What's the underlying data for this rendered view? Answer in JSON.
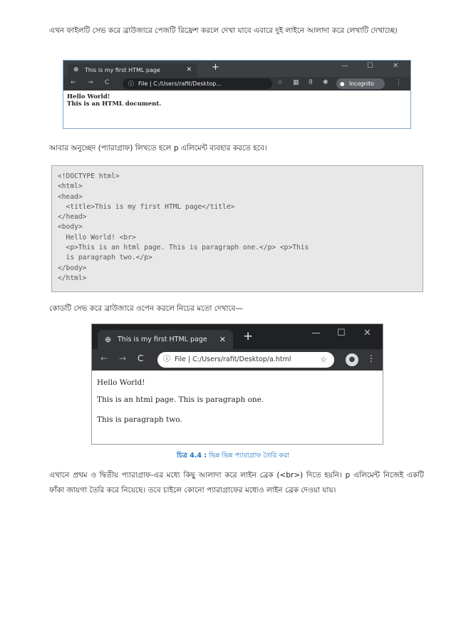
{
  "paragraphs": {
    "p1": "এখন ফাইলটি সেভ করে ব্রাউজারে পেজটি রিফ্রেশ করলে দেখা যাবে এবারে দুই লাইনে আলাদা করে লেখাটি দেখাচ্ছে।",
    "p2": "আবার অনুচ্ছেদ (প্যারাগ্রাফ) লিখতে হলে p এলিমেন্ট ব্যবহার করতে হবে।",
    "p3": "কোডটি সেভ করে ব্রাউজারে ওপেন করলে নিচের মতো দেখাবে—",
    "p4": "এখানে প্রথম ও দ্বিতীয় প্যারাগ্রাফ-এর মধ্যে কিছু আলাদা করে লাইন ব্রেক (<br>) দিতে হয়নি। p এলিমেন্ট নিজেই একটি ফাঁকা জায়গা তৈরি করে নিয়েছে। তবে চাইলে কোনো প্যারাগ্রাফের মধ্যেও লাইন ব্রেক দেওয়া যায়।"
  },
  "browser1": {
    "tab_title": "This is my first HTML page",
    "url_prefix": "File",
    "url": "C:/Users/rafit/Desktop...",
    "mode_label": "Incognito",
    "content": [
      "Hello World!",
      "This is an HTML document."
    ]
  },
  "code_lines": [
    "<!DOCTYPE html>",
    "<html>",
    "<head>",
    "  <title>This is my first HTML page</title>",
    "</head>",
    "<body>",
    "  Hello World! <br>",
    "  <p>This is an html page. This is paragraph one.</p> <p>This",
    "  is paragraph two.</p>",
    "</body>",
    "</html>"
  ],
  "browser2": {
    "tab_title": "This is my first HTML page",
    "url_prefix": "File",
    "url": "C:/Users/rafit/Desktop/a.html",
    "content": [
      "Hello World!",
      "This is an html page. This is paragraph one.",
      "This is paragraph two."
    ]
  },
  "caption": {
    "label": "চিত্র 4.4 :",
    "text": "ভিন্ন ভিন্ন প্যারাগ্রাফ তৈরি করা"
  }
}
